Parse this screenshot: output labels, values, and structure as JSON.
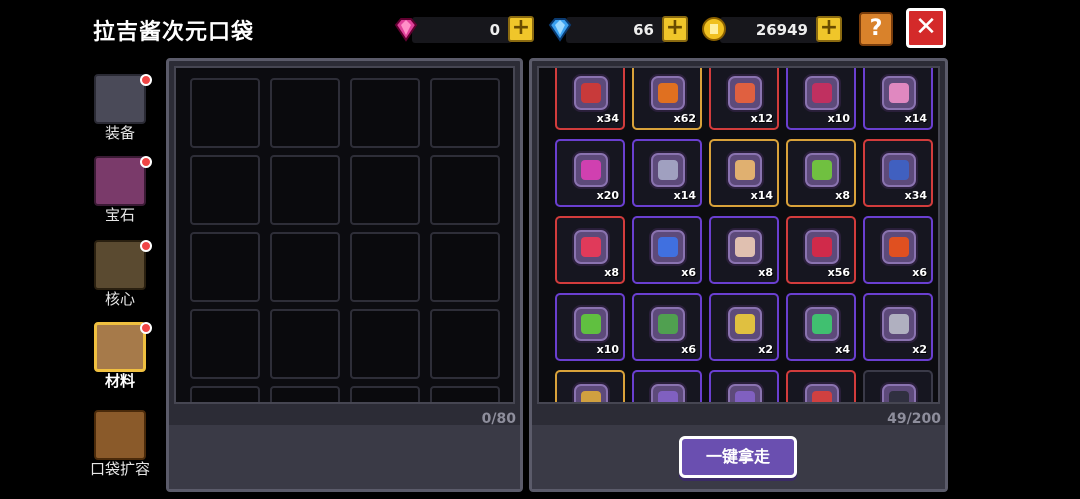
{
  "title": "拉吉酱次元口袋",
  "currency": {
    "pink_gems": "0",
    "blue_gems": "66",
    "gold_coins": "26949"
  },
  "buttons": {
    "help": "?",
    "close": "✕",
    "take_all": "一键拿走",
    "add": "+"
  },
  "sidebar": {
    "items": [
      {
        "label": "装备",
        "icon": "armor-icon",
        "dot": true
      },
      {
        "label": "宝石",
        "icon": "gem-icon",
        "dot": true
      },
      {
        "label": "核心",
        "icon": "core-icon",
        "dot": true
      },
      {
        "label": "材料",
        "icon": "materials-icon",
        "dot": true,
        "active": true
      },
      {
        "label": "口袋扩容",
        "icon": "chest-icon",
        "dot": false
      }
    ]
  },
  "left_panel": {
    "count": "0/80"
  },
  "right_panel": {
    "count": "49/200",
    "items": [
      {
        "qty": "x34",
        "rarity": "red",
        "icon": "sword-icon",
        "color": "#c83a3a"
      },
      {
        "qty": "x62",
        "rarity": "gold",
        "icon": "sun-gem-icon",
        "color": "#e07020"
      },
      {
        "qty": "x12",
        "rarity": "red",
        "icon": "ore-icon",
        "color": "#e06040"
      },
      {
        "qty": "x10",
        "rarity": "purple",
        "icon": "hook-icon",
        "color": "#c03060"
      },
      {
        "qty": "x14",
        "rarity": "purple",
        "icon": "crystal-icon",
        "color": "#e088c0"
      },
      {
        "qty": "x20",
        "rarity": "purple",
        "icon": "heart-icon",
        "color": "#d040b0"
      },
      {
        "qty": "x14",
        "rarity": "purple",
        "icon": "crown-icon",
        "color": "#a0a0c0"
      },
      {
        "qty": "x14",
        "rarity": "gold",
        "icon": "mountain-icon",
        "color": "#e0b070"
      },
      {
        "qty": "x8",
        "rarity": "gold",
        "icon": "scroll-icon",
        "color": "#70c040"
      },
      {
        "qty": "x34",
        "rarity": "red",
        "icon": "claw-icon",
        "color": "#4060c0"
      },
      {
        "qty": "x8",
        "rarity": "red",
        "icon": "red-crystal-icon",
        "color": "#e03a5a"
      },
      {
        "qty": "x6",
        "rarity": "purple",
        "icon": "blue-gun-icon",
        "color": "#4070e0"
      },
      {
        "qty": "x8",
        "rarity": "purple",
        "icon": "horn-icon",
        "color": "#e0c0b0"
      },
      {
        "qty": "x56",
        "rarity": "red",
        "icon": "red-orb-icon",
        "color": "#d02a4a"
      },
      {
        "qty": "x6",
        "rarity": "purple",
        "icon": "flame-orb-icon",
        "color": "#e05020"
      },
      {
        "qty": "x10",
        "rarity": "purple",
        "icon": "green-gun-icon",
        "color": "#60c040"
      },
      {
        "qty": "x6",
        "rarity": "purple",
        "icon": "cactus-icon",
        "color": "#50a050"
      },
      {
        "qty": "x2",
        "rarity": "purple",
        "icon": "tree-icon",
        "color": "#e0c040"
      },
      {
        "qty": "x4",
        "rarity": "purple",
        "icon": "slime-icon",
        "color": "#40c070"
      },
      {
        "qty": "x2",
        "rarity": "purple",
        "icon": "wrench-icon",
        "color": "#b0b0c0"
      },
      {
        "qty": "",
        "rarity": "gold",
        "icon": "partial-item-icon",
        "color": "#d0a040"
      },
      {
        "qty": "",
        "rarity": "purple",
        "icon": "partial-item-icon",
        "color": "#8060c0"
      },
      {
        "qty": "",
        "rarity": "purple",
        "icon": "partial-item-icon",
        "color": "#8060c0"
      },
      {
        "qty": "",
        "rarity": "red",
        "icon": "partial-item-icon",
        "color": "#d04040"
      },
      {
        "qty": "",
        "rarity": "dark",
        "icon": "partial-item-icon",
        "color": "#303040"
      }
    ]
  },
  "colors": {
    "pink_gem": "#e0409a",
    "blue_gem": "#3aa0f0",
    "gold_coin": "#f0c020",
    "panel_border": "#5b5b6a"
  }
}
